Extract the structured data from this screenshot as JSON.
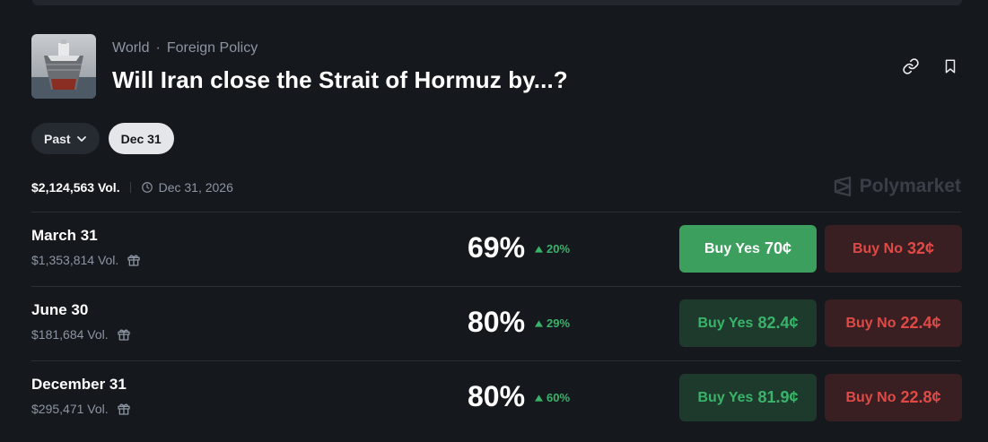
{
  "header": {
    "breadcrumb": [
      "World",
      "Foreign Policy"
    ],
    "separator": "·",
    "title": "Will Iran close the Strait of Hormuz by...?"
  },
  "filters": {
    "past_label": "Past",
    "selected_label": "Dec 31"
  },
  "meta": {
    "volume": "$2,124,563 Vol.",
    "end_date": "Dec 31, 2026"
  },
  "brand": "Polymarket",
  "outcomes": [
    {
      "name": "March 31",
      "volume": "$1,353,814 Vol.",
      "probability": "69%",
      "change": "20%",
      "buy_yes_label": "Buy Yes",
      "buy_yes_price": "70¢",
      "buy_no_label": "Buy No",
      "buy_no_price": "32¢"
    },
    {
      "name": "June 30",
      "volume": "$181,684 Vol.",
      "probability": "80%",
      "change": "29%",
      "buy_yes_label": "Buy Yes",
      "buy_yes_price": "82.4¢",
      "buy_no_label": "Buy No",
      "buy_no_price": "22.4¢"
    },
    {
      "name": "December 31",
      "volume": "$295,471 Vol.",
      "probability": "80%",
      "change": "60%",
      "buy_yes_label": "Buy Yes",
      "buy_yes_price": "81.9¢",
      "buy_no_label": "Buy No",
      "buy_no_price": "22.8¢"
    }
  ],
  "colors": {
    "background": "#15181d",
    "green": "#3ab36a",
    "red": "#e04a46",
    "muted": "#8d95a3"
  }
}
